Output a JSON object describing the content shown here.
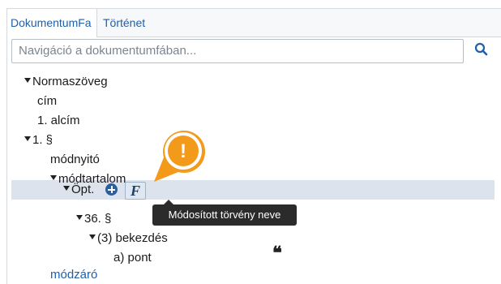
{
  "tabs": [
    {
      "label": "DokumentumFa",
      "active": true
    },
    {
      "label": "Történet",
      "active": false
    }
  ],
  "search": {
    "placeholder": "Navigáció a dokumentumfában...",
    "value": "",
    "button_icon": "search-icon"
  },
  "tree": {
    "normaszoveg": "Normaszöveg",
    "cim": "cím",
    "alcim": "1. alcím",
    "paragrafus": "1. §",
    "modnyito": "módnyitó",
    "modtartalom": "módtartalom",
    "opt": "Öpt.",
    "p36": "36. §",
    "bekezdes": "(3) bekezdés",
    "pont": "a) pont",
    "modzaro": "módzáró"
  },
  "actions": {
    "add_icon": "plus-circle-icon",
    "function_button": "F",
    "quote_icon": "quote-icon",
    "quote_glyph": "❝"
  },
  "tooltip": {
    "text": "Módosított törvény neve"
  },
  "callout": {
    "symbol": "!",
    "color": "#f39a1a"
  },
  "colors": {
    "link": "#1f5fa8",
    "highlight": "#dde3ec",
    "accent": "#f39a1a"
  }
}
